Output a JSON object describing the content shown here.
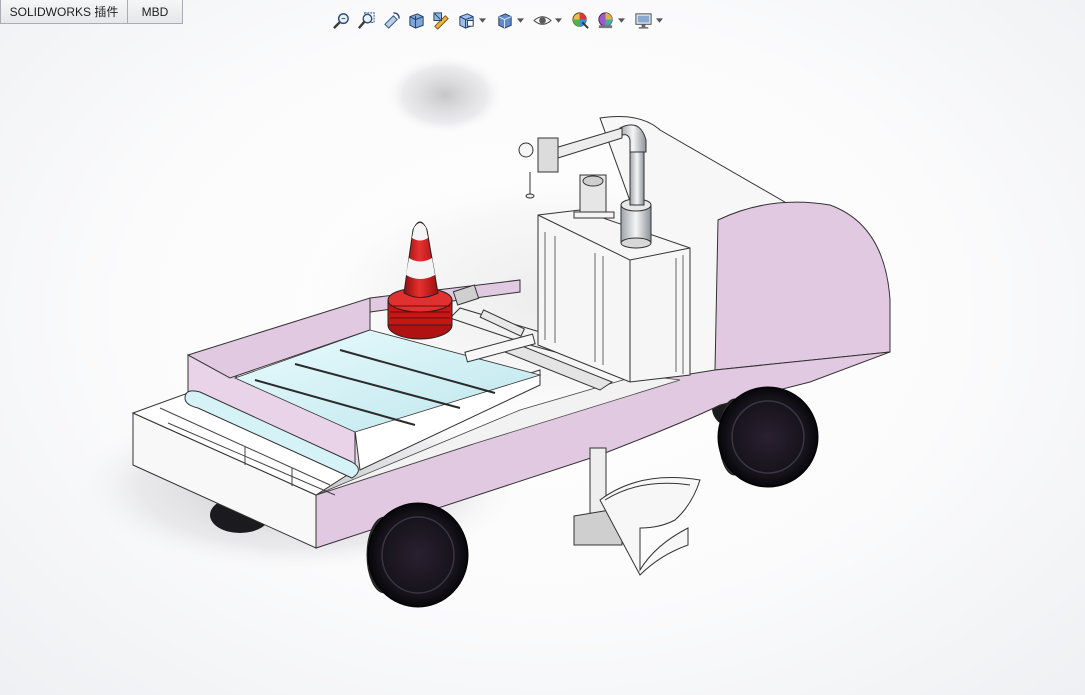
{
  "app": {
    "name": "SOLIDWORKS",
    "tabs": [
      {
        "label": "SOLIDWORKS 插件"
      },
      {
        "label": "MBD"
      }
    ]
  },
  "view_toolbar": {
    "tools": [
      {
        "name": "zoom-to-fit-icon"
      },
      {
        "name": "zoom-to-area-icon"
      },
      {
        "name": "previous-view-icon"
      },
      {
        "name": "section-view-icon"
      },
      {
        "name": "dynamic-annotation-views-icon"
      },
      {
        "name": "view-orientation-icon",
        "dropdown": true
      },
      {
        "name": "display-style-icon",
        "dropdown": true
      },
      {
        "name": "hide-show-items-icon",
        "dropdown": true
      },
      {
        "name": "edit-appearance-icon"
      },
      {
        "name": "apply-scene-icon",
        "dropdown": true
      },
      {
        "name": "view-settings-icon",
        "dropdown": true
      }
    ]
  },
  "model": {
    "body_color": "#e2c9e2",
    "tray_color": "#d4f4f8",
    "cone_color": "#e01e1e",
    "frame_color": "#f4f4f4",
    "wheel_color": "#1a1a1f"
  }
}
